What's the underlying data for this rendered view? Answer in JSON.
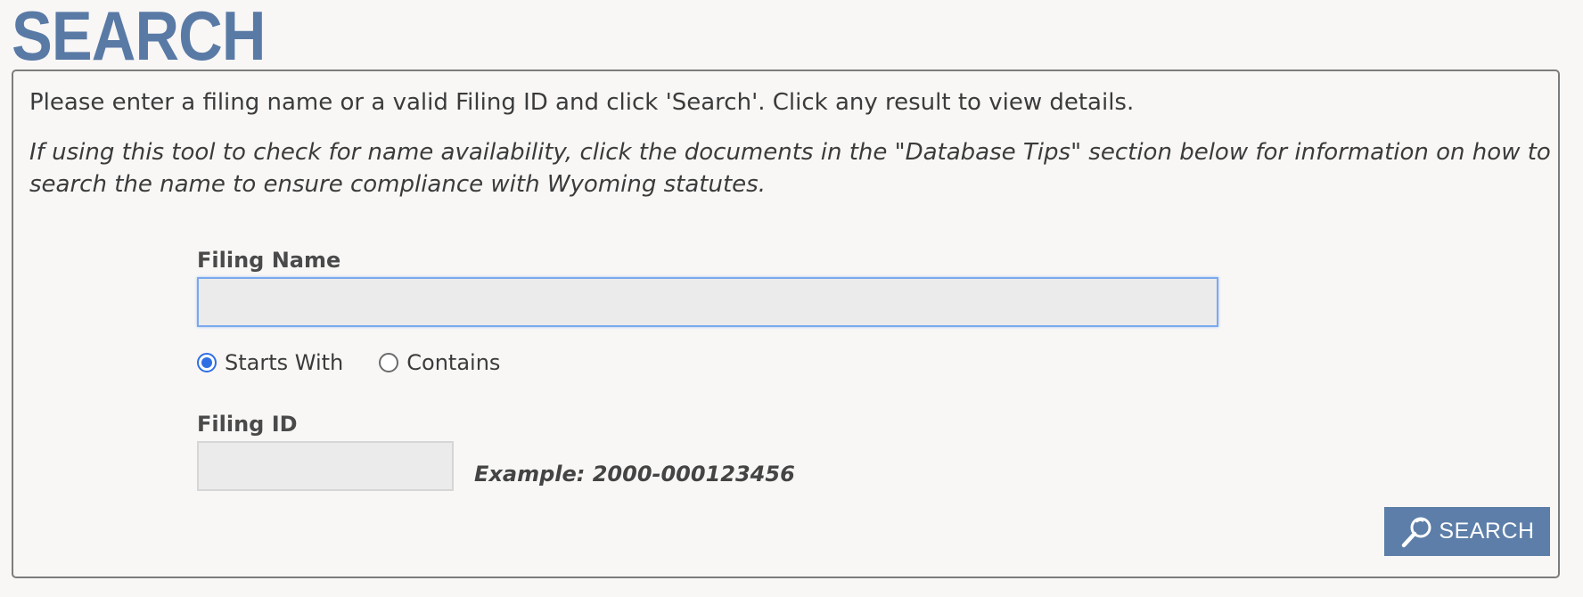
{
  "page": {
    "title": "SEARCH"
  },
  "instructions": {
    "intro": "Please enter a filing name or a valid Filing ID and click 'Search'. Click any result to view details.",
    "tip": "If using this tool to check for name availability, click the documents in the \"Database Tips\" section below for information on how to search the name to ensure compliance with Wyoming statutes."
  },
  "filing_name": {
    "label": "Filing Name",
    "value": "",
    "placeholder": ""
  },
  "match_mode": {
    "options": [
      {
        "label": "Starts With",
        "checked": true
      },
      {
        "label": "Contains",
        "checked": false
      }
    ]
  },
  "filing_id": {
    "label": "Filing ID",
    "value": "",
    "placeholder": "",
    "example": "Example: 2000-000123456"
  },
  "search_button": {
    "label": "SEARCH",
    "icon": "search-icon"
  },
  "colors": {
    "accent": "#5a7aa6",
    "radio_selected": "#2f6fe4",
    "focus_border": "#7aa9ee"
  }
}
